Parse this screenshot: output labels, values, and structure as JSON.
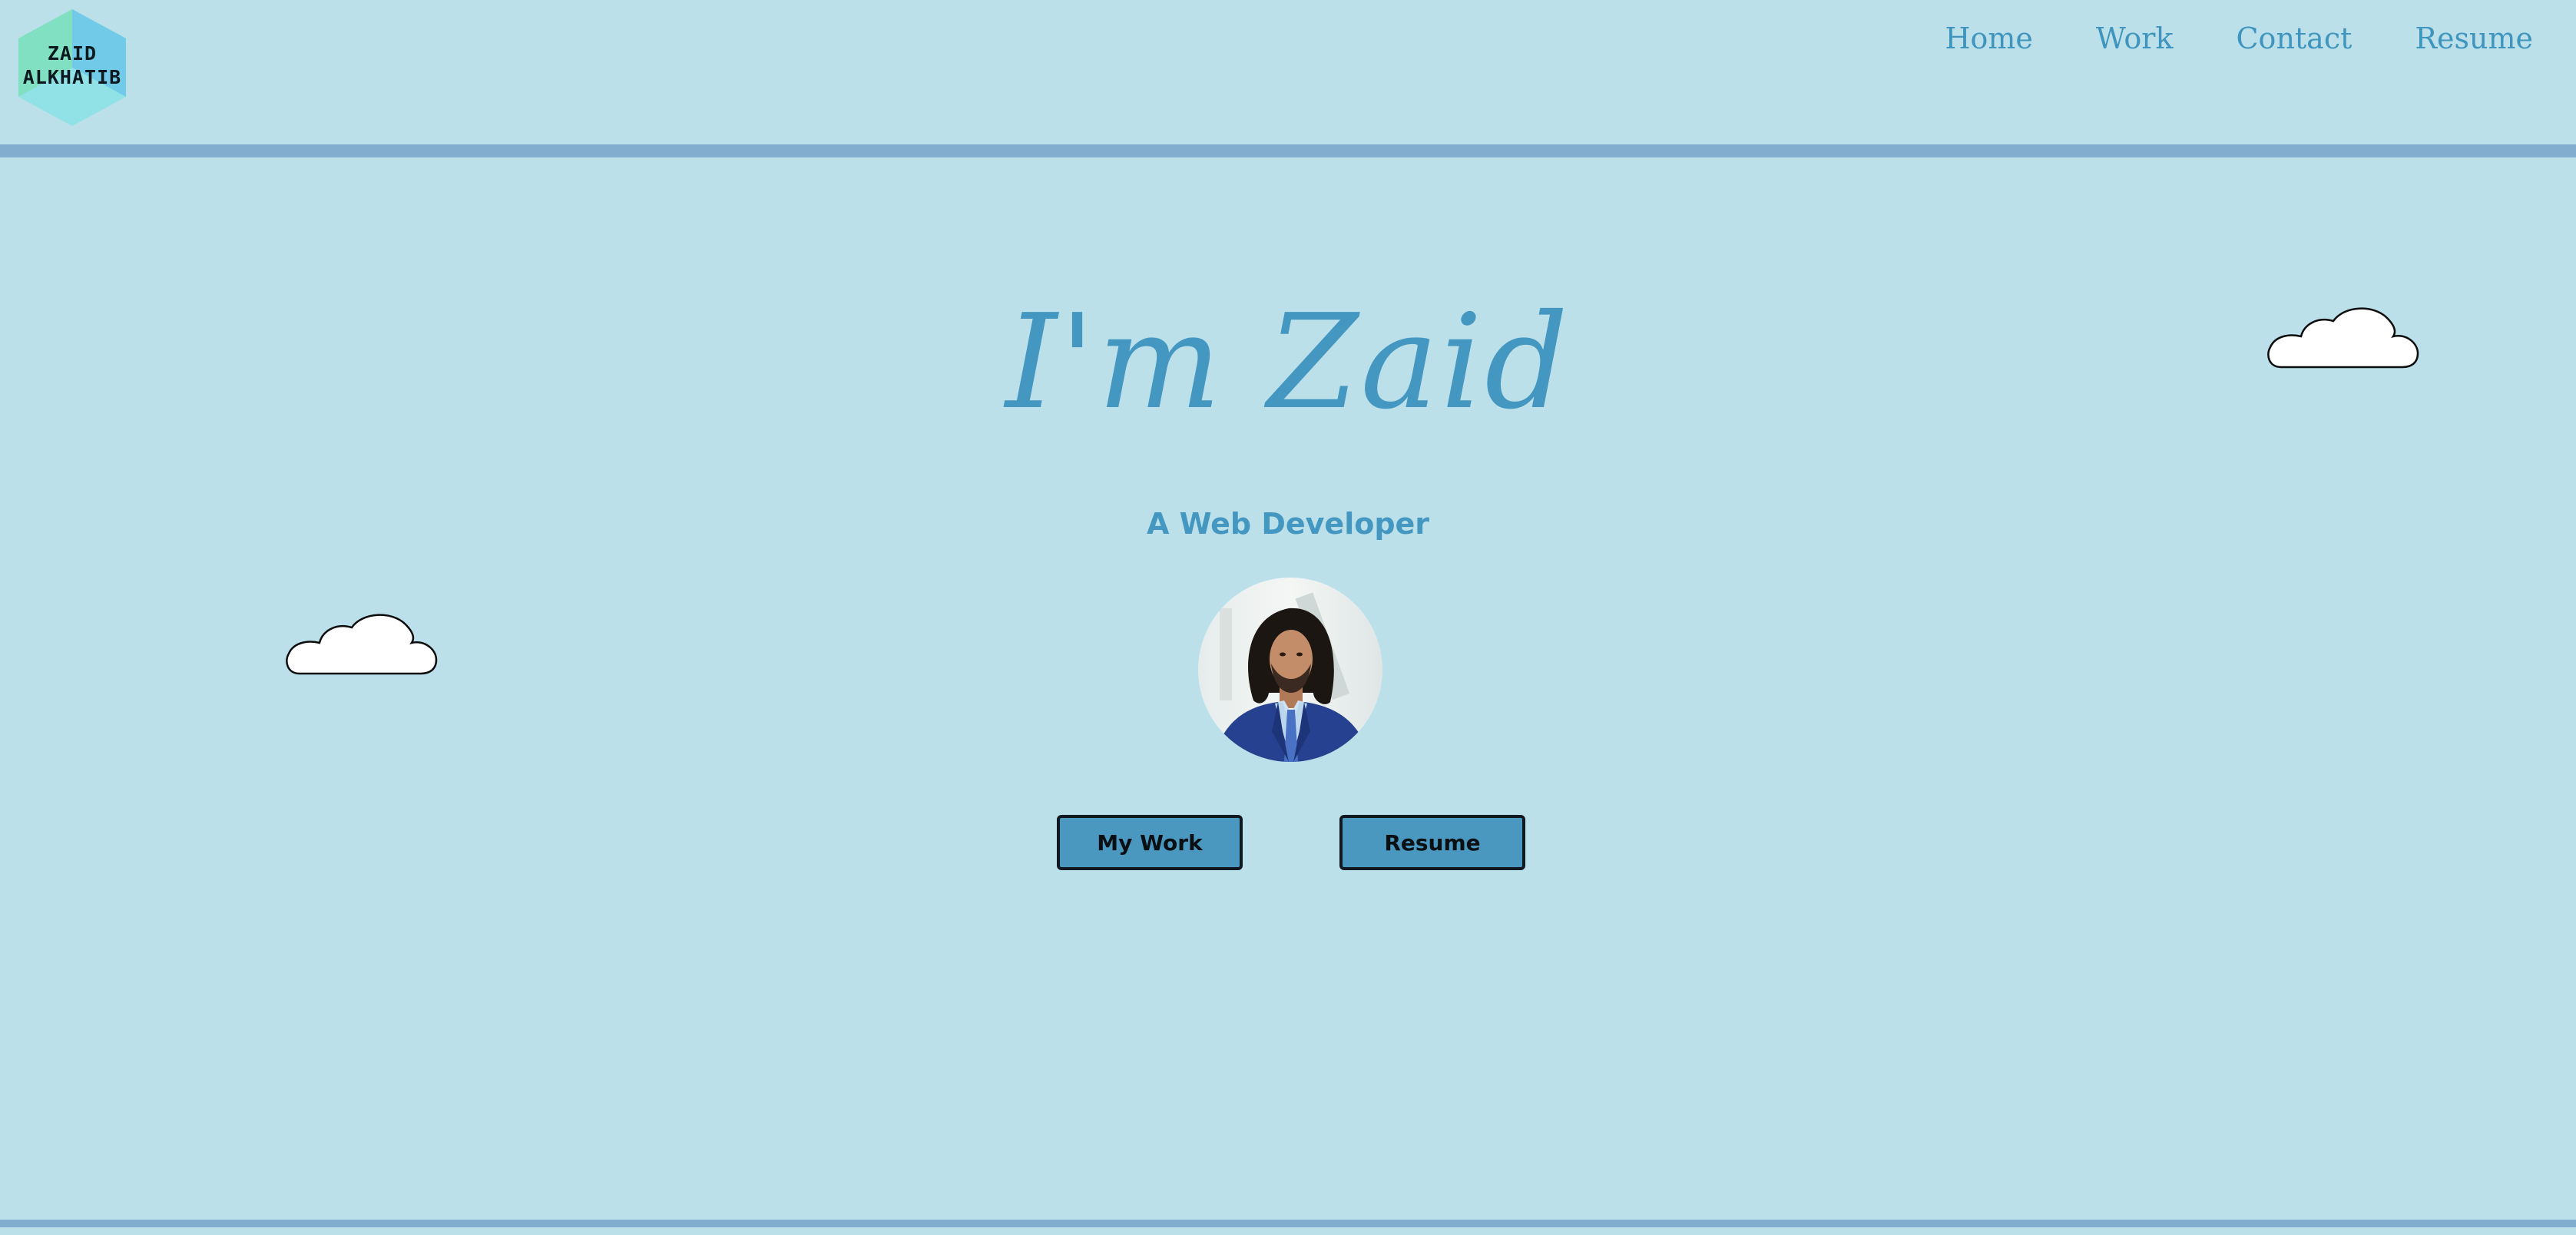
{
  "logo": {
    "line1": "ZAID",
    "line2": "ALKHATIB",
    "colors": [
      "#7fe0bd",
      "#6ec9e8",
      "#8fdde6"
    ]
  },
  "nav": {
    "items": [
      {
        "label": "Home"
      },
      {
        "label": "Work"
      },
      {
        "label": "Contact"
      },
      {
        "label": "Resume"
      }
    ]
  },
  "hero": {
    "title": "I'm Zaid",
    "subtitle": "A Web Developer",
    "avatar_icon": "person-portrait-icon"
  },
  "buttons": {
    "work_label": "My Work",
    "resume_label": "Resume"
  },
  "decor": {
    "cloud_icon": "cloud-icon"
  },
  "colors": {
    "background": "#bbe0ea",
    "accent": "#4497c0",
    "rule": "#82adcf",
    "button": "#4a97bf"
  }
}
